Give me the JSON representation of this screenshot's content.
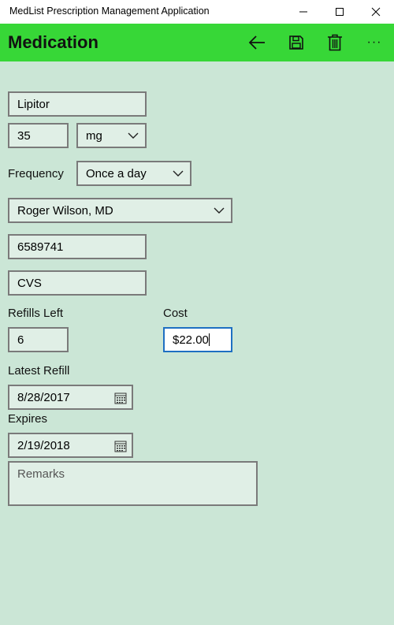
{
  "window": {
    "title": "MedList Prescription Management Application"
  },
  "appbar": {
    "heading": "Medication",
    "actions": {
      "back_icon": "arrow-left",
      "save_icon": "floppy-disk",
      "delete_icon": "trash-can",
      "more_label": "···"
    }
  },
  "form": {
    "name": "Lipitor",
    "dose_amount": "35",
    "dose_unit": "mg",
    "frequency_label": "Frequency",
    "frequency": "Once a day",
    "doctor": "Roger Wilson, MD",
    "rx_number": "6589741",
    "pharmacy": "CVS",
    "refills_label": "Refills Left",
    "refills": "6",
    "cost_label": "Cost",
    "cost": "$22.00",
    "latest_refill_label": "Latest Refill",
    "latest_refill": "8/28/2017",
    "expires_label": "Expires",
    "expires": "2/19/2018",
    "remarks_placeholder": "Remarks"
  },
  "colors": {
    "appbar": "#37d737",
    "background": "#cbe6d6",
    "field": "#e0efe6",
    "focus_border": "#1e6fc2"
  }
}
